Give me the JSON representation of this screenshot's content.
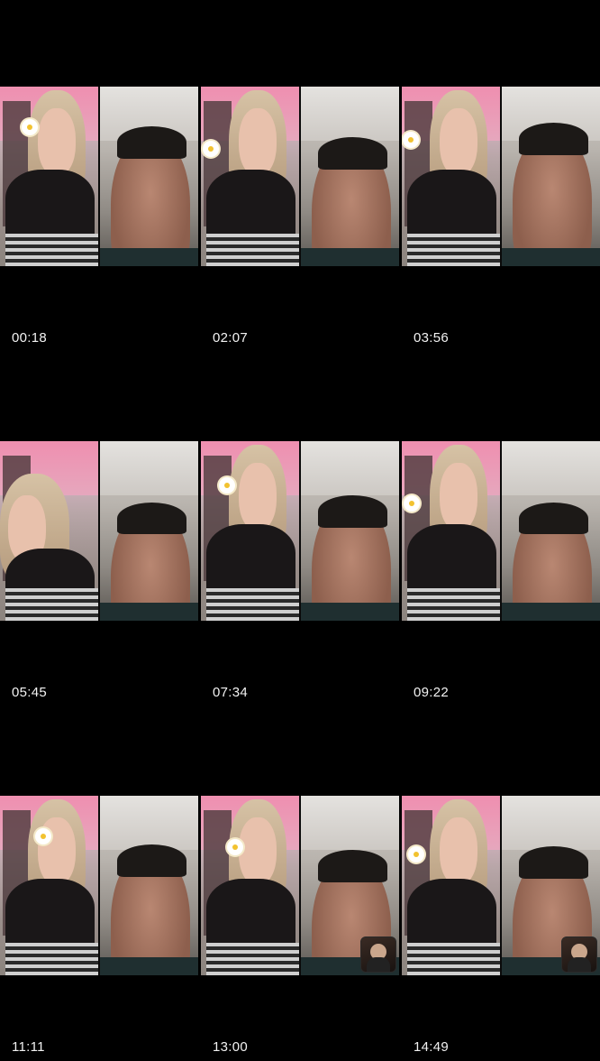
{
  "gallery": {
    "items": [
      {
        "duration": "00:18",
        "has_thumbnail": false
      },
      {
        "duration": "02:07",
        "has_thumbnail": false
      },
      {
        "duration": "03:56",
        "has_thumbnail": false
      },
      {
        "duration": "05:45",
        "has_thumbnail": false
      },
      {
        "duration": "07:34",
        "has_thumbnail": false
      },
      {
        "duration": "09:22",
        "has_thumbnail": false
      },
      {
        "duration": "11:11",
        "has_thumbnail": false
      },
      {
        "duration": "13:00",
        "has_thumbnail": true
      },
      {
        "duration": "14:49",
        "has_thumbnail": true
      }
    ]
  },
  "colors": {
    "background": "#000000",
    "timestamp_text": "#f2f2f2",
    "accent_pink": "#ef8fb0"
  }
}
